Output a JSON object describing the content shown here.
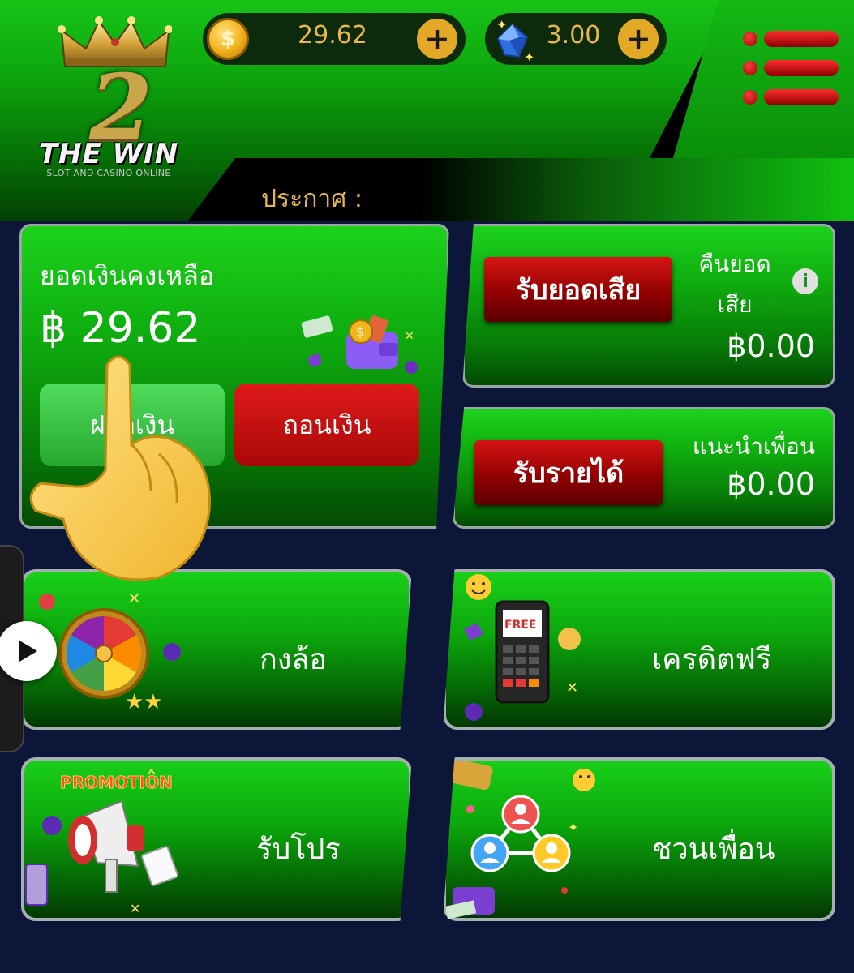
{
  "header": {
    "logo": {
      "numeral": "2",
      "title": "THE WIN",
      "subtitle": "SLOT AND CASINO ONLINE"
    },
    "coins": {
      "icon": "coin-icon",
      "value": "29.62",
      "add_icon": "plus-icon"
    },
    "gems": {
      "icon": "gem-icon",
      "value": "3.00",
      "add_icon": "plus-icon"
    },
    "menu_icon": "hamburger-menu-icon",
    "announcement_label": "ประกาศ :"
  },
  "balance": {
    "label": "ยอดเงินคงเหลือ",
    "value": "฿ 29.62",
    "deposit_label": "ฝากเงิน",
    "withdraw_label": "ถอนเงิน"
  },
  "rebate": {
    "button_label": "รับยอดเสีย",
    "title": "คืนยอดเสีย",
    "amount": "฿0.00",
    "info_icon": "info-icon"
  },
  "referral": {
    "button_label": "รับรายได้",
    "title": "แนะนำเพื่อน",
    "amount": "฿0.00"
  },
  "tiles": {
    "wheel": {
      "label": "กงล้อ",
      "icon": "prize-wheel-icon"
    },
    "credit": {
      "label": "เครดิตฟรี",
      "icon": "free-credit-phone-icon",
      "badge": "FREE"
    },
    "promo": {
      "label": "รับโปร",
      "icon": "megaphone-icon",
      "badge": "PROMOTION"
    },
    "invite": {
      "label": "ชวนเพื่อน",
      "icon": "invite-friends-icon"
    }
  },
  "floating": {
    "play_icon": "play-icon",
    "hand_icon": "pointing-hand-icon"
  },
  "colors": {
    "background": "#0b1638",
    "green": "#0fae0f",
    "red": "#a80808",
    "gold": "#e8b64a"
  }
}
